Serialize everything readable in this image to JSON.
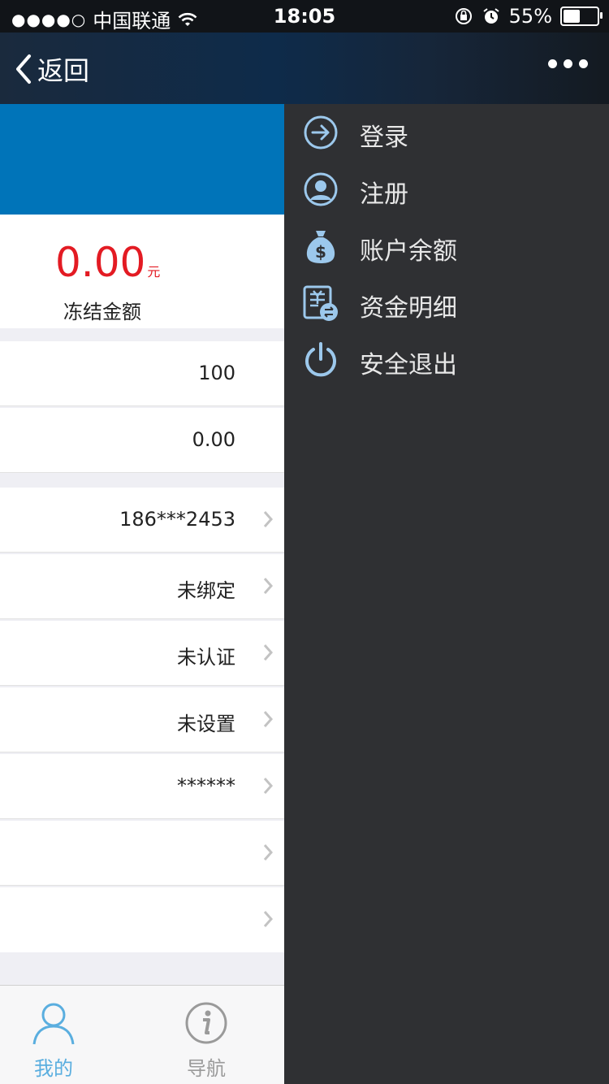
{
  "status_bar": {
    "signal": "●●●●○",
    "carrier": "中国联通",
    "time": "18:05",
    "battery": "55%",
    "battery_level": 0.55
  },
  "nav": {
    "back_label": "返回"
  },
  "frozen": {
    "amount": "0.00",
    "unit": "元",
    "label": "冻结金额"
  },
  "rows_group1": [
    {
      "value": "100"
    },
    {
      "value": "0.00"
    }
  ],
  "rows_group2": [
    {
      "value": "186***2453"
    },
    {
      "value": "未绑定"
    },
    {
      "value": "未认证"
    },
    {
      "value": "未设置"
    },
    {
      "value": "******"
    },
    {
      "value": ""
    },
    {
      "value": ""
    }
  ],
  "tabbar": {
    "items": [
      {
        "label": "我的",
        "icon": "user-icon",
        "color": "#5aaedf"
      },
      {
        "label": "导航",
        "icon": "info-icon",
        "color": "#9a9a9a"
      }
    ]
  },
  "drawer": {
    "items": [
      {
        "label": "登录",
        "icon": "login-arrow-icon"
      },
      {
        "label": "注册",
        "icon": "register-user-icon"
      },
      {
        "label": "账户余额",
        "icon": "money-bag-icon"
      },
      {
        "label": "资金明细",
        "icon": "fund-detail-icon"
      },
      {
        "label": "安全退出",
        "icon": "power-icon"
      }
    ]
  },
  "colors": {
    "banner": "#0074b9",
    "amount_red": "#e31b23",
    "drawer_bg": "#2f3033",
    "icon_blue": "#9cc8ec"
  }
}
